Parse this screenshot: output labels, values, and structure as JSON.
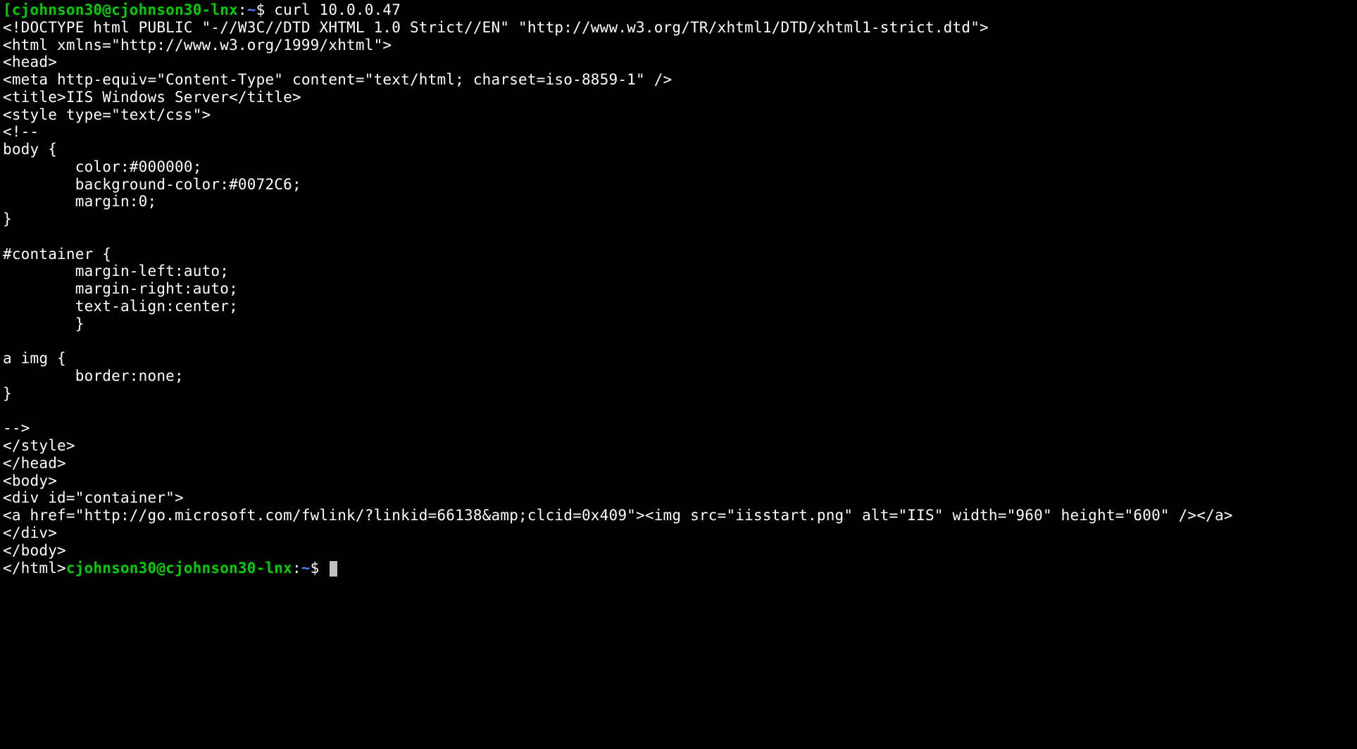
{
  "prompt1": {
    "open": "[",
    "userhost": "cjohnson30@cjohnson30-lnx",
    "sep": ":",
    "path": "~",
    "dollar": "$ ",
    "cmd": "curl 10.0.0.47"
  },
  "out": {
    "l01": "<!DOCTYPE html PUBLIC \"-//W3C//DTD XHTML 1.0 Strict//EN\" \"http://www.w3.org/TR/xhtml1/DTD/xhtml1-strict.dtd\">",
    "l02": "<html xmlns=\"http://www.w3.org/1999/xhtml\">",
    "l03": "<head>",
    "l04": "<meta http-equiv=\"Content-Type\" content=\"text/html; charset=iso-8859-1\" />",
    "l05": "<title>IIS Windows Server</title>",
    "l06": "<style type=\"text/css\">",
    "l07": "<!--",
    "l08": "body {",
    "l09": "        color:#000000;",
    "l10": "        background-color:#0072C6;",
    "l11": "        margin:0;",
    "l12": "}",
    "l13": "",
    "l14": "#container {",
    "l15": "        margin-left:auto;",
    "l16": "        margin-right:auto;",
    "l17": "        text-align:center;",
    "l18": "        }",
    "l19": "",
    "l20": "a img {",
    "l21": "        border:none;",
    "l22": "}",
    "l23": "",
    "l24": "-->",
    "l25": "</style>",
    "l26": "</head>",
    "l27": "<body>",
    "l28": "<div id=\"container\">",
    "l29": "<a href=\"http://go.microsoft.com/fwlink/?linkid=66138&amp;clcid=0x409\"><img src=\"iisstart.png\" alt=\"IIS\" width=\"960\" height=\"600\" /></a>",
    "l30": "</div>",
    "l31": "</body>",
    "l32": "</html>"
  },
  "prompt2": {
    "userhost": "cjohnson30@cjohnson30-lnx",
    "sep": ":",
    "path": "~",
    "dollar": "$ "
  }
}
